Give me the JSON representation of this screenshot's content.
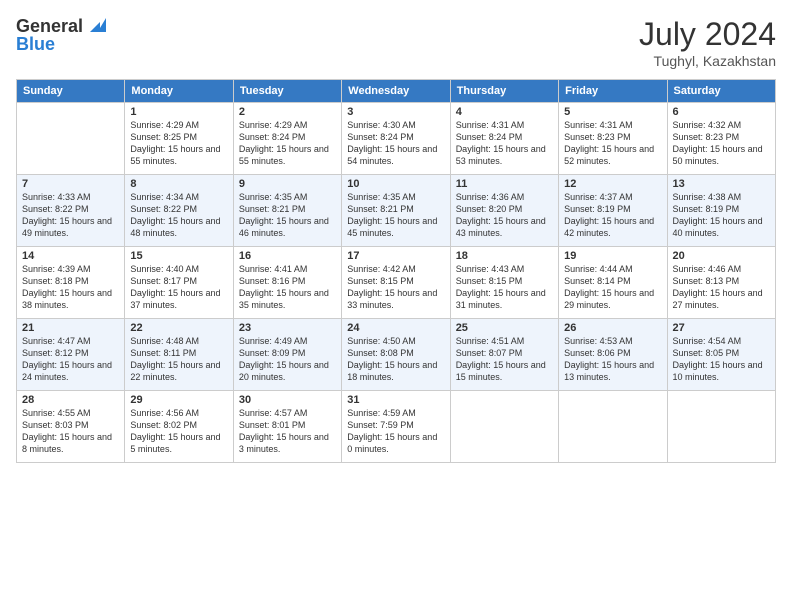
{
  "header": {
    "logo": {
      "line1": "General",
      "line2": "Blue"
    },
    "title": "July 2024",
    "location": "Tughyl, Kazakhstan"
  },
  "calendar": {
    "weekdays": [
      "Sunday",
      "Monday",
      "Tuesday",
      "Wednesday",
      "Thursday",
      "Friday",
      "Saturday"
    ],
    "weeks": [
      [
        {
          "day": "",
          "sunrise": "",
          "sunset": "",
          "daylight": ""
        },
        {
          "day": "1",
          "sunrise": "Sunrise: 4:29 AM",
          "sunset": "Sunset: 8:25 PM",
          "daylight": "Daylight: 15 hours and 55 minutes."
        },
        {
          "day": "2",
          "sunrise": "Sunrise: 4:29 AM",
          "sunset": "Sunset: 8:24 PM",
          "daylight": "Daylight: 15 hours and 55 minutes."
        },
        {
          "day": "3",
          "sunrise": "Sunrise: 4:30 AM",
          "sunset": "Sunset: 8:24 PM",
          "daylight": "Daylight: 15 hours and 54 minutes."
        },
        {
          "day": "4",
          "sunrise": "Sunrise: 4:31 AM",
          "sunset": "Sunset: 8:24 PM",
          "daylight": "Daylight: 15 hours and 53 minutes."
        },
        {
          "day": "5",
          "sunrise": "Sunrise: 4:31 AM",
          "sunset": "Sunset: 8:23 PM",
          "daylight": "Daylight: 15 hours and 52 minutes."
        },
        {
          "day": "6",
          "sunrise": "Sunrise: 4:32 AM",
          "sunset": "Sunset: 8:23 PM",
          "daylight": "Daylight: 15 hours and 50 minutes."
        }
      ],
      [
        {
          "day": "7",
          "sunrise": "Sunrise: 4:33 AM",
          "sunset": "Sunset: 8:22 PM",
          "daylight": "Daylight: 15 hours and 49 minutes."
        },
        {
          "day": "8",
          "sunrise": "Sunrise: 4:34 AM",
          "sunset": "Sunset: 8:22 PM",
          "daylight": "Daylight: 15 hours and 48 minutes."
        },
        {
          "day": "9",
          "sunrise": "Sunrise: 4:35 AM",
          "sunset": "Sunset: 8:21 PM",
          "daylight": "Daylight: 15 hours and 46 minutes."
        },
        {
          "day": "10",
          "sunrise": "Sunrise: 4:35 AM",
          "sunset": "Sunset: 8:21 PM",
          "daylight": "Daylight: 15 hours and 45 minutes."
        },
        {
          "day": "11",
          "sunrise": "Sunrise: 4:36 AM",
          "sunset": "Sunset: 8:20 PM",
          "daylight": "Daylight: 15 hours and 43 minutes."
        },
        {
          "day": "12",
          "sunrise": "Sunrise: 4:37 AM",
          "sunset": "Sunset: 8:19 PM",
          "daylight": "Daylight: 15 hours and 42 minutes."
        },
        {
          "day": "13",
          "sunrise": "Sunrise: 4:38 AM",
          "sunset": "Sunset: 8:19 PM",
          "daylight": "Daylight: 15 hours and 40 minutes."
        }
      ],
      [
        {
          "day": "14",
          "sunrise": "Sunrise: 4:39 AM",
          "sunset": "Sunset: 8:18 PM",
          "daylight": "Daylight: 15 hours and 38 minutes."
        },
        {
          "day": "15",
          "sunrise": "Sunrise: 4:40 AM",
          "sunset": "Sunset: 8:17 PM",
          "daylight": "Daylight: 15 hours and 37 minutes."
        },
        {
          "day": "16",
          "sunrise": "Sunrise: 4:41 AM",
          "sunset": "Sunset: 8:16 PM",
          "daylight": "Daylight: 15 hours and 35 minutes."
        },
        {
          "day": "17",
          "sunrise": "Sunrise: 4:42 AM",
          "sunset": "Sunset: 8:15 PM",
          "daylight": "Daylight: 15 hours and 33 minutes."
        },
        {
          "day": "18",
          "sunrise": "Sunrise: 4:43 AM",
          "sunset": "Sunset: 8:15 PM",
          "daylight": "Daylight: 15 hours and 31 minutes."
        },
        {
          "day": "19",
          "sunrise": "Sunrise: 4:44 AM",
          "sunset": "Sunset: 8:14 PM",
          "daylight": "Daylight: 15 hours and 29 minutes."
        },
        {
          "day": "20",
          "sunrise": "Sunrise: 4:46 AM",
          "sunset": "Sunset: 8:13 PM",
          "daylight": "Daylight: 15 hours and 27 minutes."
        }
      ],
      [
        {
          "day": "21",
          "sunrise": "Sunrise: 4:47 AM",
          "sunset": "Sunset: 8:12 PM",
          "daylight": "Daylight: 15 hours and 24 minutes."
        },
        {
          "day": "22",
          "sunrise": "Sunrise: 4:48 AM",
          "sunset": "Sunset: 8:11 PM",
          "daylight": "Daylight: 15 hours and 22 minutes."
        },
        {
          "day": "23",
          "sunrise": "Sunrise: 4:49 AM",
          "sunset": "Sunset: 8:09 PM",
          "daylight": "Daylight: 15 hours and 20 minutes."
        },
        {
          "day": "24",
          "sunrise": "Sunrise: 4:50 AM",
          "sunset": "Sunset: 8:08 PM",
          "daylight": "Daylight: 15 hours and 18 minutes."
        },
        {
          "day": "25",
          "sunrise": "Sunrise: 4:51 AM",
          "sunset": "Sunset: 8:07 PM",
          "daylight": "Daylight: 15 hours and 15 minutes."
        },
        {
          "day": "26",
          "sunrise": "Sunrise: 4:53 AM",
          "sunset": "Sunset: 8:06 PM",
          "daylight": "Daylight: 15 hours and 13 minutes."
        },
        {
          "day": "27",
          "sunrise": "Sunrise: 4:54 AM",
          "sunset": "Sunset: 8:05 PM",
          "daylight": "Daylight: 15 hours and 10 minutes."
        }
      ],
      [
        {
          "day": "28",
          "sunrise": "Sunrise: 4:55 AM",
          "sunset": "Sunset: 8:03 PM",
          "daylight": "Daylight: 15 hours and 8 minutes."
        },
        {
          "day": "29",
          "sunrise": "Sunrise: 4:56 AM",
          "sunset": "Sunset: 8:02 PM",
          "daylight": "Daylight: 15 hours and 5 minutes."
        },
        {
          "day": "30",
          "sunrise": "Sunrise: 4:57 AM",
          "sunset": "Sunset: 8:01 PM",
          "daylight": "Daylight: 15 hours and 3 minutes."
        },
        {
          "day": "31",
          "sunrise": "Sunrise: 4:59 AM",
          "sunset": "Sunset: 7:59 PM",
          "daylight": "Daylight: 15 hours and 0 minutes."
        },
        {
          "day": "",
          "sunrise": "",
          "sunset": "",
          "daylight": ""
        },
        {
          "day": "",
          "sunrise": "",
          "sunset": "",
          "daylight": ""
        },
        {
          "day": "",
          "sunrise": "",
          "sunset": "",
          "daylight": ""
        }
      ]
    ]
  }
}
